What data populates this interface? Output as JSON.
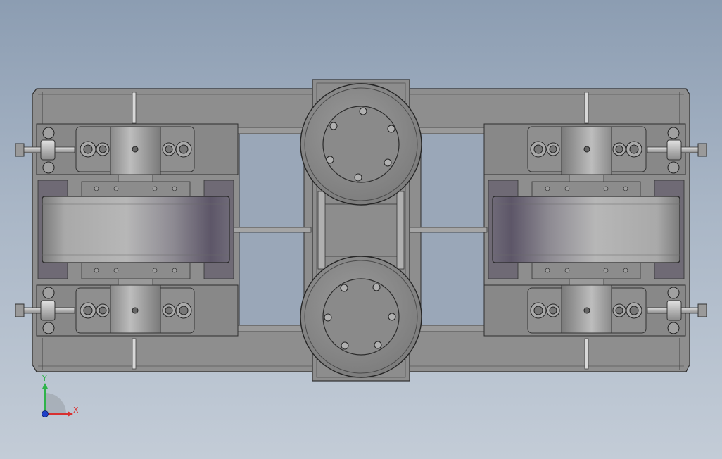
{
  "triad": {
    "y_label": "Y",
    "x_label": "X",
    "y_color": "#2fb34a",
    "x_color": "#d83030",
    "z_color": "#2040c8"
  },
  "colors": {
    "background_top": "#8c9db2",
    "background_bottom": "#c3ccd7",
    "body": "#8e8e8e",
    "outline": "#2e2e2e"
  }
}
